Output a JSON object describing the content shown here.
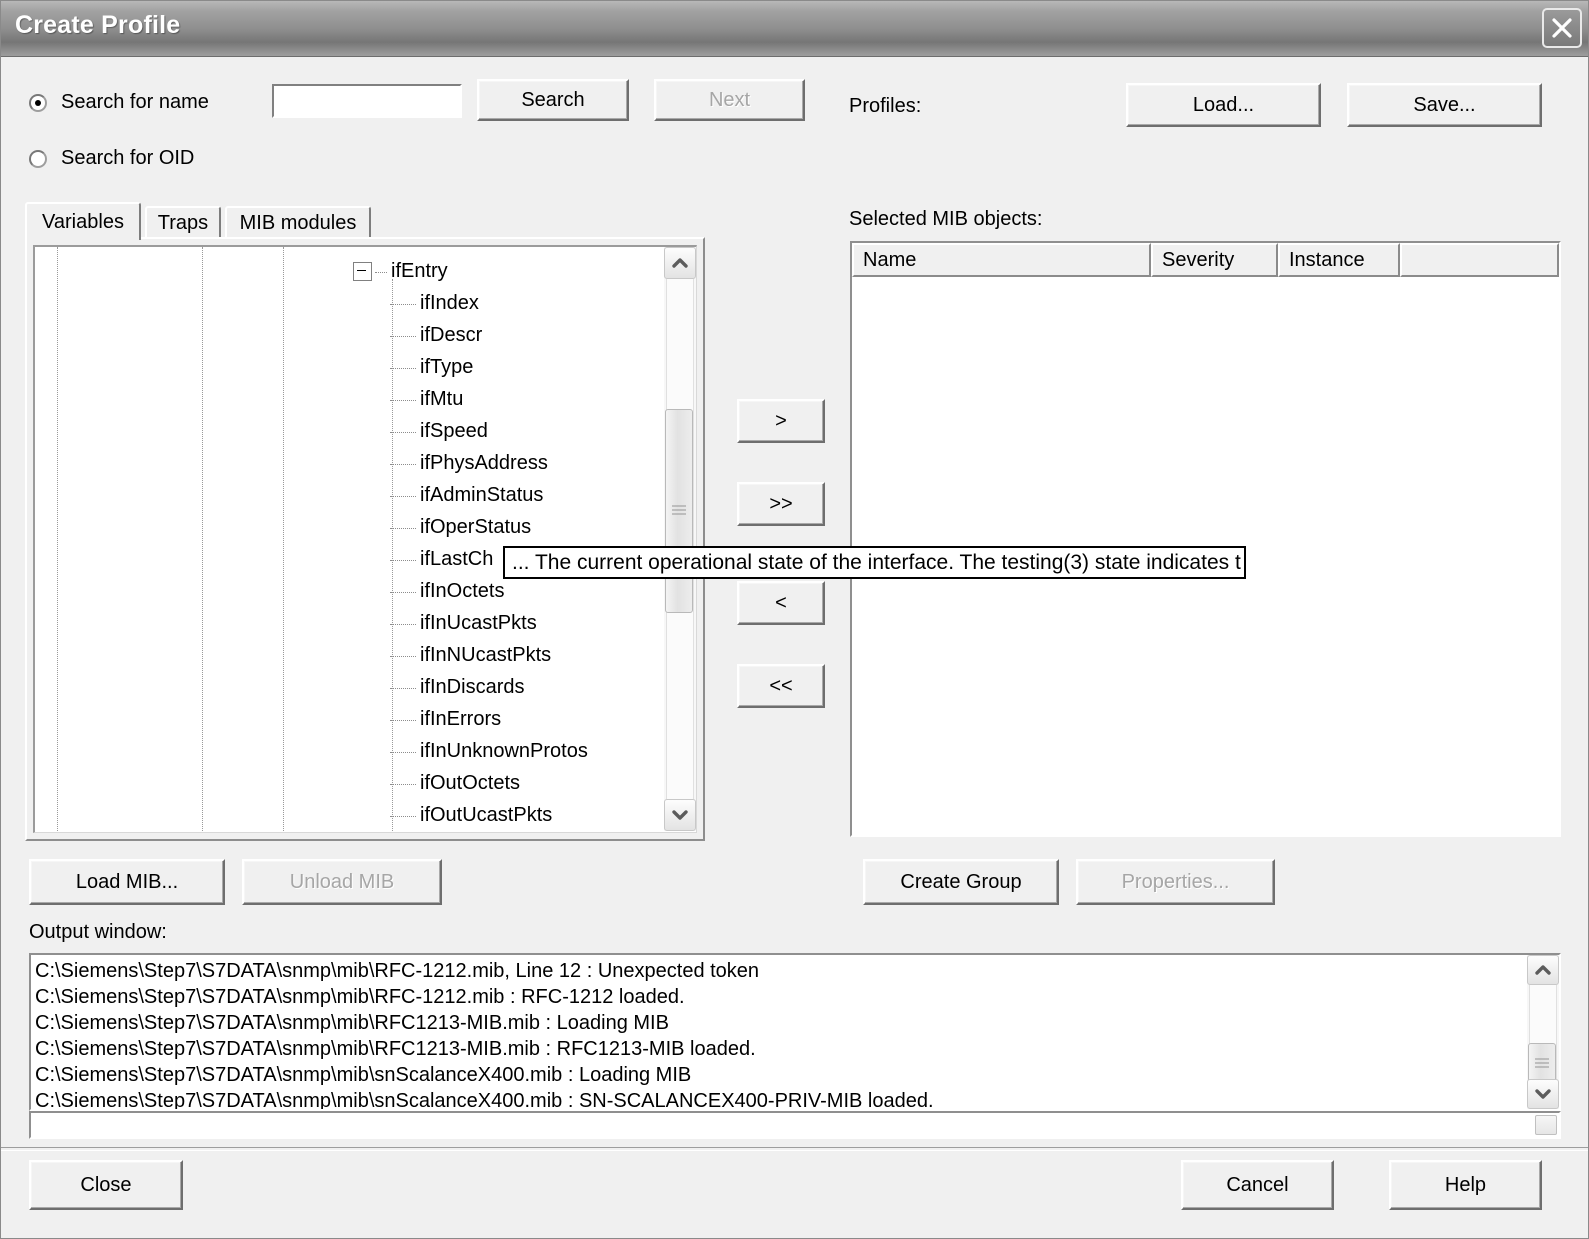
{
  "window": {
    "title": "Create Profile",
    "close_icon": "close-icon"
  },
  "search": {
    "radio_name_label": "Search for name",
    "radio_oid_label": "Search for OID",
    "selected": "name",
    "input_value": "",
    "input_placeholder": "",
    "search_button": "Search",
    "next_button": "Next",
    "next_enabled": false
  },
  "profiles": {
    "label": "Profiles:",
    "load_button": "Load...",
    "save_button": "Save..."
  },
  "tabs": [
    {
      "label": "Variables",
      "active": true
    },
    {
      "label": "Traps",
      "active": false
    },
    {
      "label": "MIB modules",
      "active": false
    }
  ],
  "tree": {
    "root": {
      "label": "ifEntry",
      "expanded": true,
      "expander_icon": "minus-box-icon"
    },
    "children": [
      "ifIndex",
      "ifDescr",
      "ifType",
      "ifMtu",
      "ifSpeed",
      "ifPhysAddress",
      "ifAdminStatus",
      "ifOperStatus",
      "ifLastCh",
      "ifInOctets",
      "ifInUcastPkts",
      "ifInNUcastPkts",
      "ifInDiscards",
      "ifInErrors",
      "ifInUnknownProtos",
      "ifOutOctets",
      "ifOutUcastPkts"
    ],
    "scrollbar": {
      "up_icon": "chevron-up-icon",
      "down_icon": "chevron-down-icon",
      "thumb_icon": "grip-icon"
    }
  },
  "tooltip": {
    "text": "... The current operational state of the interface. The testing(3) state indicates t"
  },
  "transfer_buttons": [
    {
      "label": ">",
      "name": "move-right-button"
    },
    {
      "label": ">>",
      "name": "move-all-right-button"
    },
    {
      "label": "<",
      "name": "move-left-button"
    },
    {
      "label": "<<",
      "name": "move-all-left-button"
    }
  ],
  "selected_objects": {
    "label": "Selected MIB objects:",
    "columns": [
      "Name",
      "Severity",
      "Instance",
      ""
    ],
    "rows": []
  },
  "mib_buttons": {
    "load_mib": "Load MIB...",
    "unload_mib": "Unload MIB",
    "unload_mib_enabled": false,
    "create_group": "Create Group",
    "properties": "Properties...",
    "properties_enabled": false
  },
  "output": {
    "label": "Output window:",
    "lines": [
      "C:\\Siemens\\Step7\\S7DATA\\snmp\\mib\\RFC-1212.mib, Line 12 : Unexpected token",
      "C:\\Siemens\\Step7\\S7DATA\\snmp\\mib\\RFC-1212.mib : RFC-1212 loaded.",
      "C:\\Siemens\\Step7\\S7DATA\\snmp\\mib\\RFC1213-MIB.mib : Loading MIB",
      "C:\\Siemens\\Step7\\S7DATA\\snmp\\mib\\RFC1213-MIB.mib : RFC1213-MIB loaded.",
      "C:\\Siemens\\Step7\\S7DATA\\snmp\\mib\\snScalanceX400.mib : Loading MIB",
      "C:\\Siemens\\Step7\\S7DATA\\snmp\\mib\\snScalanceX400.mib : SN-SCALANCEX400-PRIV-MIB loaded."
    ],
    "scrollbar": {
      "up_icon": "chevron-up-icon",
      "down_icon": "chevron-down-icon"
    }
  },
  "footer": {
    "close_button": "Close",
    "cancel_button": "Cancel",
    "help_button": "Help"
  },
  "colors": {
    "dialog_face": "#f0f0f0",
    "titlebar_dark": "#767676",
    "titlebar_light": "#b8b8b8",
    "text": "#000000",
    "disabled_text": "#a6a6a6"
  }
}
